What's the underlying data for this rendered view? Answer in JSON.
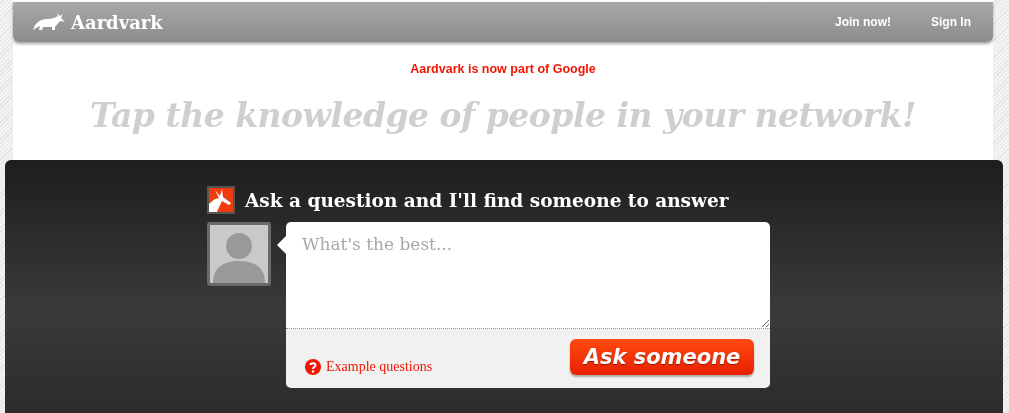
{
  "header": {
    "logo": "Aardvark",
    "links": [
      "Join now!",
      "Sign In"
    ]
  },
  "notice": "Aardvark is now part of Google",
  "tagline": "Tap the knowledge of people in your network!",
  "ask": {
    "heading": "Ask a question and I'll find someone to answer",
    "question": {
      "placeholder": "What's the best..."
    },
    "example_link": "Example questions",
    "button": "Ask someone"
  }
}
